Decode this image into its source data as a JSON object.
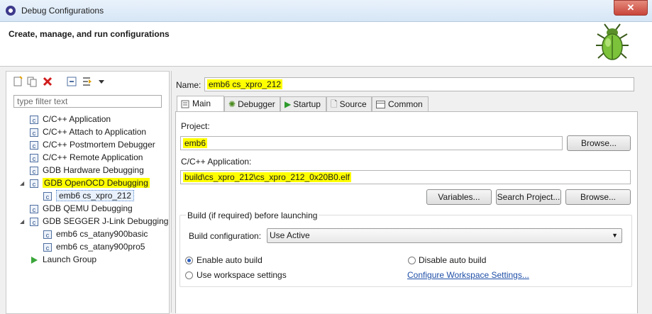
{
  "window": {
    "title": "Debug Configurations",
    "close_glyph": "✕"
  },
  "banner": {
    "heading": "Create, manage, and run configurations"
  },
  "left": {
    "filter_placeholder": "type filter text",
    "toolbar_icons": [
      "new-configuration-icon",
      "duplicate-icon",
      "delete-icon",
      "collapse-all-icon",
      "filter-icon",
      "dropdown-arrow-icon"
    ],
    "tree": [
      {
        "label": "C/C++ Application",
        "level": 0
      },
      {
        "label": "C/C++ Attach to Application",
        "level": 0
      },
      {
        "label": "C/C++ Postmortem Debugger",
        "level": 0
      },
      {
        "label": "C/C++ Remote Application",
        "level": 0
      },
      {
        "label": "GDB Hardware Debugging",
        "level": 0
      },
      {
        "label": "GDB OpenOCD Debugging",
        "level": 0,
        "expanded": true,
        "highlighted": true
      },
      {
        "label": "emb6 cs_xpro_212",
        "level": 1,
        "selected": true
      },
      {
        "label": "GDB QEMU Debugging",
        "level": 0
      },
      {
        "label": "GDB SEGGER J-Link Debugging",
        "level": 0,
        "expanded": true
      },
      {
        "label": "emb6 cs_atany900basic",
        "level": 1
      },
      {
        "label": "emb6 cs_atany900pro5",
        "level": 1
      },
      {
        "label": "Launch Group",
        "level": 0
      }
    ]
  },
  "right": {
    "name_label": "Name:",
    "name_value": "emb6 cs_xpro_212",
    "tabs": [
      "Main",
      "Debugger",
      "Startup",
      "Source",
      "Common"
    ],
    "project_label": "Project:",
    "project_value": "emb6",
    "browse_label": "Browse...",
    "app_label": "C/C++ Application:",
    "app_value": "build\\cs_xpro_212\\cs_xpro_212_0x20B0.elf",
    "variables_label": "Variables...",
    "search_project_label": "Search Project...",
    "build_group_label": "Build (if required) before launching",
    "build_config_label": "Build configuration:",
    "build_config_value": "Use Active",
    "enable_auto_build": "Enable auto build",
    "disable_auto_build": "Disable auto build",
    "use_workspace_settings": "Use workspace settings",
    "configure_workspace_link": "Configure Workspace Settings..."
  }
}
